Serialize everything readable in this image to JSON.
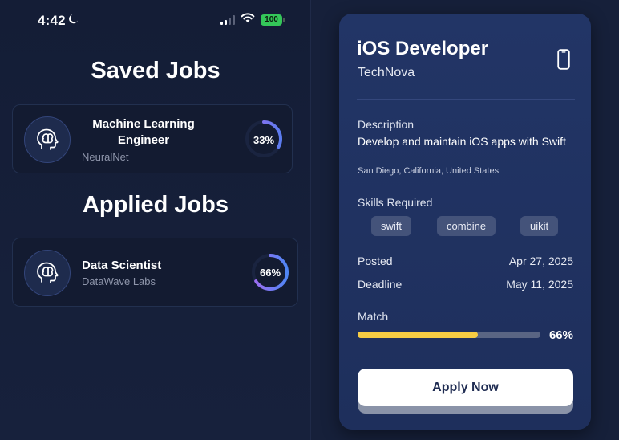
{
  "status_bar": {
    "time": "4:42",
    "battery": "100"
  },
  "saved_section": {
    "title": "Saved Jobs",
    "jobs": [
      {
        "title_line1": "Machine Learning",
        "title_line2": "Engineer",
        "company": "NeuralNet",
        "match": "33%",
        "match_value": 0.33,
        "icon": "brain-icon"
      }
    ]
  },
  "applied_section": {
    "title": "Applied Jobs",
    "jobs": [
      {
        "title": "Data Scientist",
        "company": "DataWave Labs",
        "match": "66%",
        "match_value": 0.66,
        "icon": "brain-icon"
      }
    ]
  },
  "detail": {
    "title": "iOS Developer",
    "company": "TechNova",
    "icon": "phone-icon",
    "description_label": "Description",
    "description": "Develop and maintain iOS apps with Swift",
    "location": "San Diego, California, United States",
    "skills_label": "Skills Required",
    "skills": [
      "swift",
      "combine",
      "uikit"
    ],
    "posted_label": "Posted",
    "posted": "Apr 27, 2025",
    "deadline_label": "Deadline",
    "deadline": "May 11, 2025",
    "match_label": "Match",
    "match": "66%",
    "match_value": 0.66,
    "apply_label": "Apply Now"
  },
  "colors": {
    "background": "#16203a",
    "card": "#223566",
    "ring_gradient_start": "#8b5cf6",
    "ring_gradient_end": "#3b82f6",
    "match_bar": "#f7cc43",
    "battery": "#34c759"
  }
}
